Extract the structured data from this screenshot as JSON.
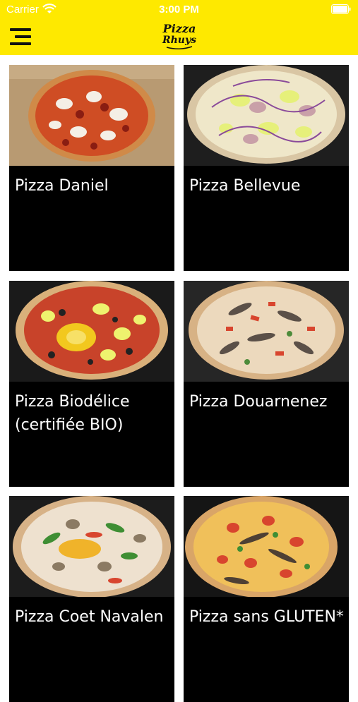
{
  "status_bar": {
    "carrier": "Carrier",
    "time": "3:00 PM"
  },
  "header": {
    "logo_line1": "Pizza",
    "logo_line2": "Rhuys",
    "accent_color": "#fee900"
  },
  "pizzas": [
    {
      "name": "Pizza Daniel",
      "photo": "pizza-photo-tomato-mozzarella-chorizo"
    },
    {
      "name": "Pizza Bellevue",
      "photo": "pizza-photo-white-ham-onion"
    },
    {
      "name": "Pizza Biodélice (certifiée BIO)",
      "photo": "pizza-photo-egg-cheese-olives"
    },
    {
      "name": "Pizza Douarnenez",
      "photo": "pizza-photo-sardines-tomato"
    },
    {
      "name": "Pizza Coet Navalen",
      "photo": "pizza-photo-vegetables-mushrooms"
    },
    {
      "name": "Pizza sans GLUTEN*",
      "photo": "pizza-photo-anchovies-tomato"
    }
  ]
}
